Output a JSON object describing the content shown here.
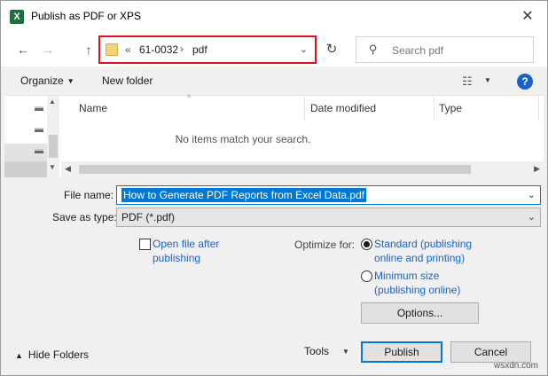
{
  "title_bar": {
    "app_icon_letter": "X",
    "title": "Publish as PDF or XPS",
    "close_glyph": "✕"
  },
  "nav": {
    "back_glyph": "←",
    "forward_glyph": "→",
    "up_glyph": "↑",
    "breadcrumb_prefix": "«",
    "breadcrumbs": [
      "61-0032",
      "pdf"
    ],
    "refresh_glyph": "↻",
    "search_placeholder": "Search pdf"
  },
  "toolbar": {
    "organize": "Organize",
    "new_folder": "New folder",
    "help": "?"
  },
  "file_list": {
    "columns": [
      "Name",
      "Date modified",
      "Type"
    ],
    "empty_message": "No items match your search."
  },
  "form": {
    "file_name_label": "File name:",
    "file_name_value": "How to Generate PDF Reports from Excel Data.pdf",
    "save_as_type_label": "Save as type:",
    "save_as_type_value": "PDF (*.pdf)",
    "open_after_line1": "Open file after",
    "open_after_line2": "publishing",
    "open_after_checked": false,
    "optimize_label": "Optimize for:",
    "optimize_standard_line1": "Standard (publishing",
    "optimize_standard_line2": "online and printing)",
    "optimize_minimum_line1": "Minimum size",
    "optimize_minimum_line2": "(publishing online)",
    "optimize_selected": "standard",
    "options_button": "Options..."
  },
  "footer": {
    "hide_folders": "Hide Folders",
    "tools": "Tools",
    "publish": "Publish",
    "cancel": "Cancel"
  },
  "watermark": "wsxdn.com",
  "colors": {
    "accent": "#0078d7",
    "highlight_box": "#e0101a",
    "link": "#1a62c7",
    "excel_green": "#1d6f42"
  }
}
